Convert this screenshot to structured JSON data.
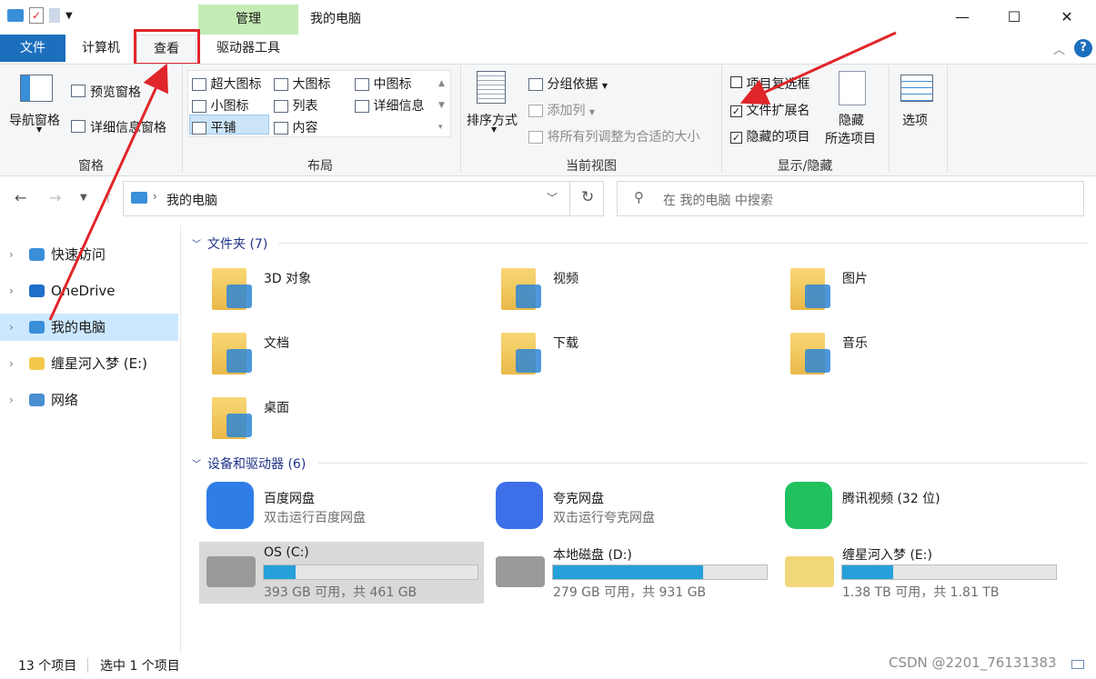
{
  "window": {
    "title": "我的电脑",
    "manage_tab": "管理",
    "minimize": "—",
    "maximize": "☐",
    "close": "✕"
  },
  "tabs": {
    "file": "文件",
    "computer": "计算机",
    "view": "查看",
    "drive_tools": "驱动器工具"
  },
  "ribbon": {
    "panes": {
      "nav_pane": "导航窗格",
      "preview_pane": "预览窗格",
      "details_pane": "详细信息窗格",
      "group": "窗格"
    },
    "layout": {
      "extra_large": "超大图标",
      "large": "大图标",
      "medium": "中图标",
      "small": "小图标",
      "list": "列表",
      "details": "详细信息",
      "tiles": "平铺",
      "content": "内容",
      "group": "布局"
    },
    "current_view": {
      "sort_by": "排序方式",
      "group_by": "分组依据",
      "add_column": "添加列",
      "fit_columns": "将所有列调整为合适的大小",
      "group": "当前视图"
    },
    "show_hide": {
      "item_checkboxes": "项目复选框",
      "file_ext": "文件扩展名",
      "hidden_items": "隐藏的项目",
      "hide_selected_1": "隐藏",
      "hide_selected_2": "所选项目",
      "group": "显示/隐藏",
      "item_checkboxes_checked": false,
      "file_ext_checked": true,
      "hidden_items_checked": true
    },
    "options": "选项"
  },
  "address": {
    "path": "我的电脑",
    "search_placeholder": "在 我的电脑 中搜索"
  },
  "sidebar": [
    {
      "label": "快速访问",
      "icon": "star-icon"
    },
    {
      "label": "OneDrive",
      "icon": "cloud-icon"
    },
    {
      "label": "我的电脑",
      "icon": "computer-icon"
    },
    {
      "label": "缠星河入梦 (E:)",
      "icon": "drive-avatar-icon"
    },
    {
      "label": "网络",
      "icon": "network-icon"
    }
  ],
  "folders": {
    "header": "文件夹 (7)",
    "items": [
      "3D 对象",
      "视频",
      "图片",
      "文档",
      "下载",
      "音乐",
      "桌面"
    ]
  },
  "devices": {
    "header": "设备和驱动器 (6)",
    "apps": [
      {
        "name": "百度网盘",
        "sub": "双击运行百度网盘"
      },
      {
        "name": "夸克网盘",
        "sub": "双击运行夸克网盘"
      },
      {
        "name": "腾讯视频 (32 位)",
        "sub": ""
      }
    ],
    "drives": [
      {
        "name": "OS (C:)",
        "info": "393 GB 可用，共 461 GB",
        "used_fraction": 0.15
      },
      {
        "name": "本地磁盘 (D:)",
        "info": "279 GB 可用，共 931 GB",
        "used_fraction": 0.7
      },
      {
        "name": "缠星河入梦 (E:)",
        "info": "1.38 TB 可用，共 1.81 TB",
        "used_fraction": 0.24
      }
    ]
  },
  "status": {
    "count": "13 个项目",
    "selected": "选中 1 个项目"
  },
  "watermark": "CSDN @2201_76131383",
  "colors": {
    "accent": "#1c6fbd",
    "manage_tab": "#c5ecb5",
    "selection": "#cce8ff",
    "annotation": "#e0262a",
    "drive_bar": "#26a0da"
  }
}
